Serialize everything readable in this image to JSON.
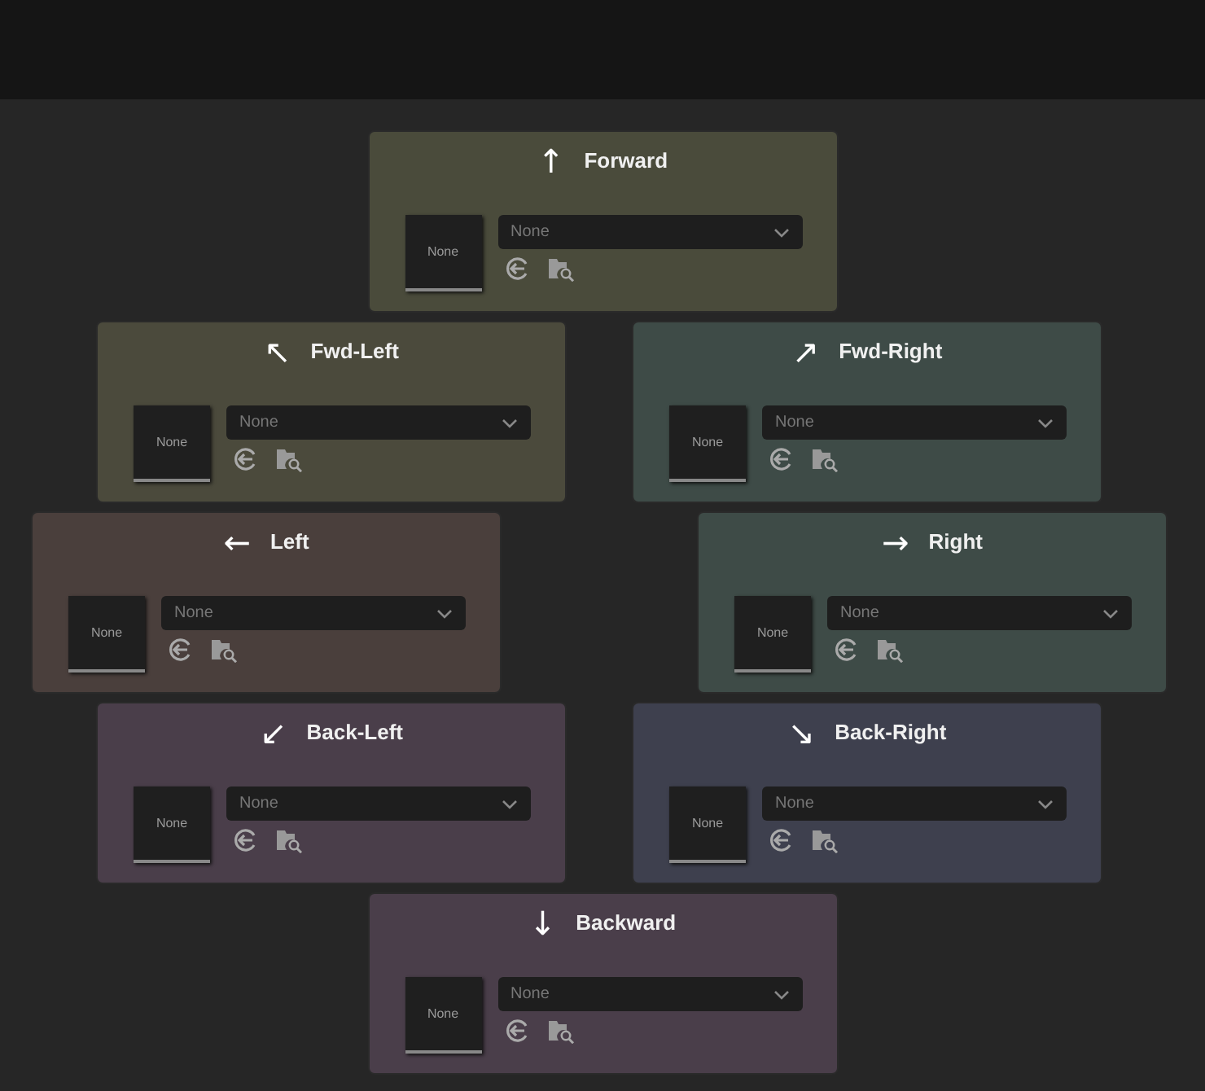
{
  "rows": [
    {
      "kind": "center",
      "cards": [
        {
          "arrow": "↑",
          "title": "Forward",
          "color": "#4a4b3b",
          "thumbnail": "None",
          "dropdown": "None"
        }
      ]
    },
    {
      "kind": "inner",
      "cards": [
        {
          "arrow": "↖",
          "title": "Fwd-Left",
          "color": "#4b4a3c",
          "thumbnail": "None",
          "dropdown": "None"
        },
        {
          "arrow": "↗",
          "title": "Fwd-Right",
          "color": "#3e4b47",
          "thumbnail": "None",
          "dropdown": "None"
        }
      ]
    },
    {
      "kind": "outer",
      "cards": [
        {
          "arrow": "←",
          "title": "Left",
          "color": "#4a3f3c",
          "thumbnail": "None",
          "dropdown": "None"
        },
        {
          "arrow": "→",
          "title": "Right",
          "color": "#3e4b47",
          "thumbnail": "None",
          "dropdown": "None"
        }
      ]
    },
    {
      "kind": "inner",
      "cards": [
        {
          "arrow": "↙",
          "title": "Back-Left",
          "color": "#4a3e4a",
          "thumbnail": "None",
          "dropdown": "None"
        },
        {
          "arrow": "↘",
          "title": "Back-Right",
          "color": "#3e404e",
          "thumbnail": "None",
          "dropdown": "None"
        }
      ]
    },
    {
      "kind": "center",
      "cards": [
        {
          "arrow": "↓",
          "title": "Backward",
          "color": "#4a3e4a",
          "thumbnail": "None",
          "dropdown": "None"
        }
      ]
    }
  ]
}
